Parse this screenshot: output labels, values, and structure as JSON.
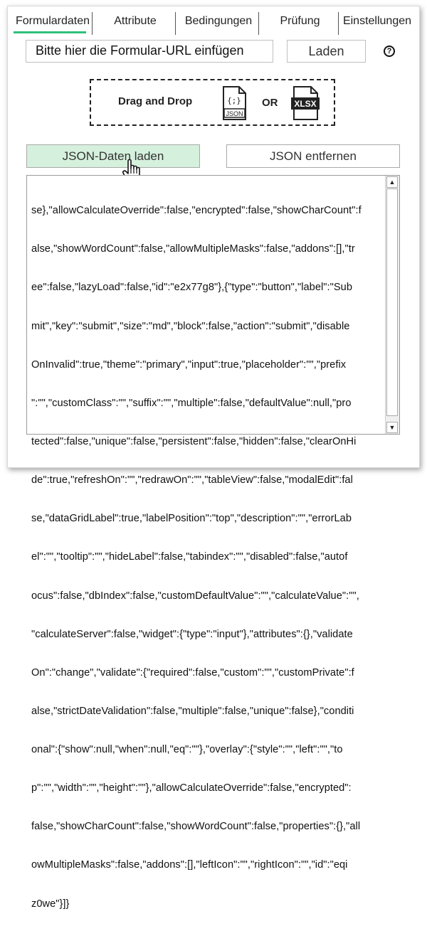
{
  "tabs": [
    {
      "label": "Formulardaten"
    },
    {
      "label": "Attribute"
    },
    {
      "label": "Bedingungen"
    },
    {
      "label": "Prüfung"
    },
    {
      "label": "Einstellungen"
    }
  ],
  "url_bar": {
    "placeholder": "Bitte hier die Formular-URL einfügen",
    "load_label": "Laden",
    "help_label": "?"
  },
  "dropzone": {
    "text": "Drag and Drop",
    "or": "OR",
    "json_icon_label": "JSON",
    "xlsx_icon_label": "XLSX"
  },
  "buttons": {
    "load_json": "JSON-Daten laden",
    "remove_json": "JSON entfernen"
  },
  "code_lines": [
    "se},\"allowCalculateOverride\":false,\"encrypted\":false,\"showCharCount\":f",
    "alse,\"showWordCount\":false,\"allowMultipleMasks\":false,\"addons\":[],\"tr",
    "ee\":false,\"lazyLoad\":false,\"id\":\"e2x77g8\"},{\"type\":\"button\",\"label\":\"Sub",
    "mit\",\"key\":\"submit\",\"size\":\"md\",\"block\":false,\"action\":\"submit\",\"disable",
    "OnInvalid\":true,\"theme\":\"primary\",\"input\":true,\"placeholder\":\"\",\"prefix",
    "\":\"\",\"customClass\":\"\",\"suffix\":\"\",\"multiple\":false,\"defaultValue\":null,\"pro",
    "tected\":false,\"unique\":false,\"persistent\":false,\"hidden\":false,\"clearOnHi",
    "de\":true,\"refreshOn\":\"\",\"redrawOn\":\"\",\"tableView\":false,\"modalEdit\":fal",
    "se,\"dataGridLabel\":true,\"labelPosition\":\"top\",\"description\":\"\",\"errorLab",
    "el\":\"\",\"tooltip\":\"\",\"hideLabel\":false,\"tabindex\":\"\",\"disabled\":false,\"autof",
    "ocus\":false,\"dbIndex\":false,\"customDefaultValue\":\"\",\"calculateValue\":\"\",",
    "\"calculateServer\":false,\"widget\":{\"type\":\"input\"},\"attributes\":{},\"validate",
    "On\":\"change\",\"validate\":{\"required\":false,\"custom\":\"\",\"customPrivate\":f",
    "alse,\"strictDateValidation\":false,\"multiple\":false,\"unique\":false},\"conditi",
    "onal\":{\"show\":null,\"when\":null,\"eq\":\"\"},\"overlay\":{\"style\":\"\",\"left\":\"\",\"to",
    "p\":\"\",\"width\":\"\",\"height\":\"\"},\"allowCalculateOverride\":false,\"encrypted\":",
    "false,\"showCharCount\":false,\"showWordCount\":false,\"properties\":{},\"all",
    "owMultipleMasks\":false,\"addons\":[],\"leftIcon\":\"\",\"rightIcon\":\"\",\"id\":\"eqi",
    "z0we\"}]}"
  ]
}
